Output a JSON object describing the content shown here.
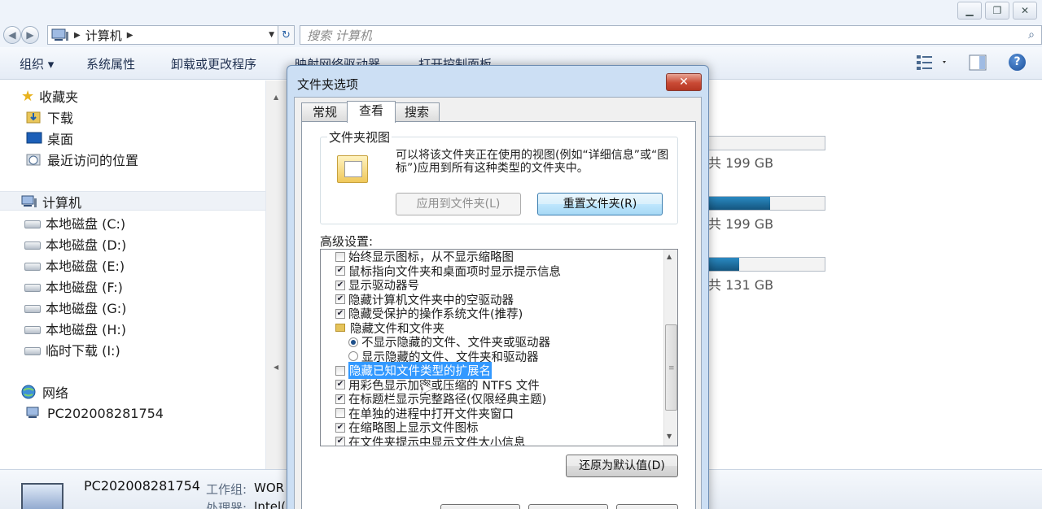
{
  "window": {
    "controls": {
      "minimize": "▭",
      "restore": "⧉",
      "close": "✕"
    }
  },
  "address": {
    "location": "计算机",
    "search_placeholder": "搜索 计算机"
  },
  "toolbar": {
    "organize": "组织 ▾",
    "system_properties": "系统属性",
    "uninstall": "卸载或更改程序",
    "map_drive": "映射网络驱动器",
    "control_panel": "打开控制面板"
  },
  "nav": {
    "favorites": "收藏夹",
    "downloads": "下载",
    "desktop": "桌面",
    "recent": "最近访问的位置",
    "computer": "计算机",
    "drives": [
      "本地磁盘 (C:)",
      "本地磁盘 (D:)",
      "本地磁盘 (E:)",
      "本地磁盘 (F:)",
      "本地磁盘 (G:)",
      "本地磁盘 (H:)",
      "临时下载 (I:)"
    ],
    "network": "网络",
    "network_pc": "PC202008281754"
  },
  "capacity": [
    {
      "free_text": "共 199 GB",
      "used_fraction": 0.0
    },
    {
      "free_text": "共 199 GB",
      "used_fraction": 0.53
    },
    {
      "free_text": "共 131 GB",
      "used_fraction": 0.26
    }
  ],
  "details": {
    "name": "PC202008281754",
    "workgroup_label": "工作组:",
    "workgroup_value": "WOR",
    "cpu_label": "处理器:",
    "cpu_value": "Intel("
  },
  "dialog": {
    "title": "文件夹选项",
    "close": "✕",
    "tabs": [
      "常规",
      "查看",
      "搜索"
    ],
    "folder_views": {
      "legend": "文件夹视图",
      "desc": "可以将该文件夹正在使用的视图(例如“详细信息”或“图标”)应用到所有这种类型的文件夹中。",
      "apply_btn": "应用到文件夹(L)",
      "reset_btn": "重置文件夹(R)"
    },
    "advanced_label": "高级设置:",
    "advanced_items": [
      {
        "text": "始终显示图标，从不显示缩略图",
        "checked": false
      },
      {
        "text": "鼠标指向文件夹和桌面项时显示提示信息",
        "checked": true
      },
      {
        "text": "显示驱动器号",
        "checked": true
      },
      {
        "text": "隐藏计算机文件夹中的空驱动器",
        "checked": true
      },
      {
        "text": "隐藏受保护的操作系统文件(推荐)",
        "checked": true
      },
      {
        "text": "隐藏文件和文件夹",
        "folder": true
      },
      {
        "text": "不显示隐藏的文件、文件夹或驱动器",
        "radio": true,
        "selected": true
      },
      {
        "text": "显示隐藏的文件、文件夹和驱动器",
        "radio": true,
        "selected": false
      },
      {
        "text": "隐藏已知文件类型的扩展名",
        "checked": false,
        "highlighted": true
      },
      {
        "text": "用彩色显示加密或压缩的 NTFS 文件",
        "checked": true
      },
      {
        "text": "在标题栏显示完整路径(仅限经典主题)",
        "checked": true
      },
      {
        "text": "在单独的进程中打开文件夹窗口",
        "checked": false
      },
      {
        "text": "在缩略图上显示文件图标",
        "checked": true
      },
      {
        "text": "在文件夹提示中显示文件大小信息",
        "checked": true
      }
    ],
    "restore_btn": "还原为默认值(D)"
  }
}
